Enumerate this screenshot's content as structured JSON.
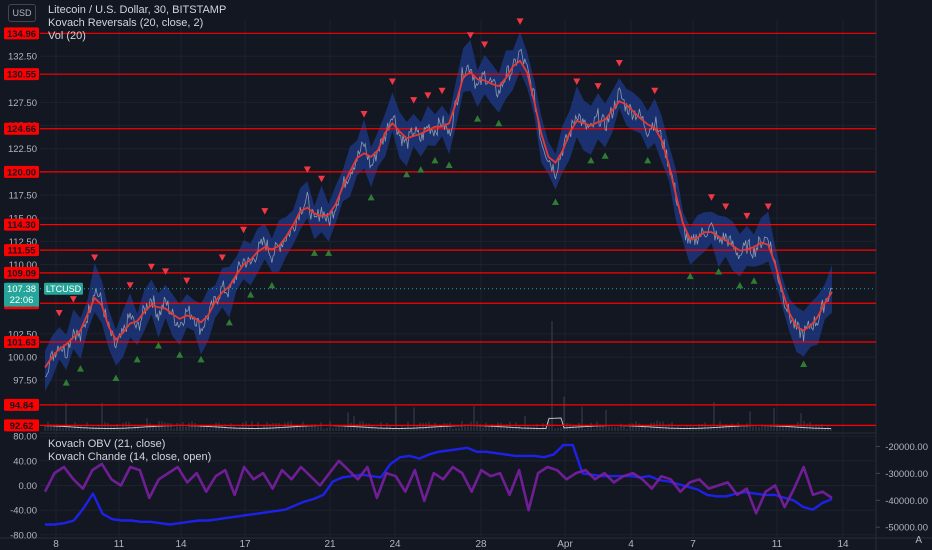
{
  "header": {
    "currency": "USD",
    "title": "Litecoin / U.S. Dollar, 30, BITSTAMP",
    "indicator_1": "Kovach Reversals (20, close, 2)",
    "indicator_2": "Vol (20)",
    "lower_indicator_1": "Kovach OBV (21, close)",
    "lower_indicator_2": "Kovach Chande (14, close, open)",
    "auto_label": "A"
  },
  "colors": {
    "background": "#131722",
    "grid": "#1e222d",
    "level_line": "#ff0000",
    "level_tag": "#ff0000",
    "price_tag": "#26a69a",
    "band": "#1e3a8a",
    "price": "#9aa5b1",
    "ma": "#e53935",
    "arrow_up": "#2e7d32",
    "arrow_down": "#f23645",
    "obv": "#1e22e8",
    "chande": "#7b1fa2",
    "volume": "#5d606b",
    "volume_ma": "#e0e0e0"
  },
  "chart_data": [
    {
      "type": "line",
      "name": "price-panel",
      "y_ticks": [
        "132.50",
        "127.50",
        "125.00",
        "122.50",
        "117.50",
        "115.00",
        "112.50",
        "110.00",
        "102.50",
        "100.00",
        "97.50"
      ],
      "y_tick_values": [
        132.5,
        127.5,
        125.0,
        122.5,
        117.5,
        115.0,
        112.5,
        110.0,
        102.5,
        100.0,
        97.5
      ],
      "ylim": [
        91.8,
        136.4
      ],
      "x_ticks": [
        "8",
        "11",
        "14",
        "17",
        "21",
        "24",
        "28",
        "Apr",
        "4",
        "7",
        "11",
        "14"
      ],
      "levels": [
        "134.96",
        "130.55",
        "124.66",
        "120.00",
        "114.30",
        "111.55",
        "109.09",
        "105.81",
        "101.63",
        "94.84",
        "92.62"
      ],
      "level_values": [
        134.96,
        130.55,
        124.66,
        120.0,
        114.3,
        111.55,
        109.09,
        105.81,
        101.63,
        94.84,
        92.62
      ],
      "current_price": {
        "symbol": "LTCUSD",
        "value": "107.38",
        "countdown": "22:06",
        "numeric": 107.38
      },
      "series": [
        {
          "values": [
            98.5,
            100.0,
            101.5,
            100.5,
            103.0,
            102.0,
            104.5,
            107.5,
            106.0,
            103.0,
            101.0,
            102.5,
            104.5,
            103.0,
            105.0,
            106.5,
            104.5,
            106.0,
            104.5,
            103.5,
            105.0,
            104.5,
            103.0,
            104.5,
            106.0,
            107.5,
            107.0,
            109.0,
            110.5,
            110.0,
            111.5,
            112.5,
            111.0,
            112.0,
            113.0,
            114.0,
            116.0,
            117.0,
            114.5,
            116.0,
            114.5,
            116.5,
            118.5,
            120.0,
            121.5,
            123.0,
            120.5,
            122.5,
            124.0,
            126.5,
            124.0,
            123.0,
            124.5,
            123.5,
            125.0,
            124.5,
            125.5,
            124.0,
            127.5,
            131.0,
            131.5,
            129.0,
            130.5,
            129.5,
            128.5,
            130.5,
            131.0,
            133.0,
            131.0,
            128.0,
            123.5,
            121.5,
            120.0,
            122.5,
            124.0,
            126.5,
            125.0,
            124.5,
            126.0,
            125.0,
            126.5,
            128.5,
            127.0,
            126.5,
            126.0,
            124.5,
            125.5,
            123.5,
            121.0,
            117.5,
            114.0,
            112.0,
            113.0,
            113.5,
            114.0,
            112.5,
            113.0,
            112.0,
            111.0,
            112.0,
            111.5,
            112.5,
            113.0,
            110.0,
            107.0,
            104.5,
            103.0,
            102.5,
            103.5,
            104.0,
            106.0,
            107.38
          ]
        }
      ]
    },
    {
      "type": "line",
      "name": "oscillator-panel",
      "left_ticks": [
        "80.00",
        "40.00",
        "0.00",
        "-40.00",
        "-80.00"
      ],
      "left_tick_values": [
        80,
        40,
        0,
        -40,
        -80
      ],
      "left_ylim": [
        -85,
        85
      ],
      "right_ticks": [
        "-20000.00",
        "-30000.00",
        "-40000.00",
        "-50000.00"
      ],
      "right_tick_values": [
        -20000,
        -30000,
        -40000,
        -50000
      ],
      "right_ylim": [
        -54000,
        -15000
      ],
      "series": [
        {
          "axis": "right",
          "values": [
            -49000,
            -49000,
            -48500,
            -47500,
            -43000,
            -37500,
            -45000,
            -47000,
            -47500,
            -47500,
            -48000,
            -48000,
            -48500,
            -49000,
            -48500,
            -48000,
            -47500,
            -47500,
            -47000,
            -46500,
            -46000,
            -45500,
            -45000,
            -44500,
            -44000,
            -43500,
            -42000,
            -40500,
            -39500,
            -38000,
            -33000,
            -31500,
            -31000,
            -30500,
            -31000,
            -31500,
            -26500,
            -24000,
            -23500,
            -24500,
            -23000,
            -22000,
            -21500,
            -21000,
            -20500,
            -22000,
            -22000,
            -22500,
            -23000,
            -23500,
            -23500,
            -23500,
            -24000,
            -23000,
            -19500,
            -19500,
            -30000,
            -30500,
            -31000,
            -31000,
            -31000,
            -31000,
            -31500,
            -31000,
            -32500,
            -33000,
            -34000,
            -35000,
            -36000,
            -38000,
            -38500,
            -38500,
            -37500,
            -37000,
            -37500,
            -38000,
            -38000,
            -39000,
            -40000,
            -42500,
            -43500,
            -41000,
            -39500
          ]
        },
        {
          "axis": "left",
          "values": [
            -10,
            20,
            30,
            10,
            -5,
            25,
            35,
            10,
            0,
            30,
            25,
            -20,
            10,
            20,
            30,
            5,
            20,
            -10,
            15,
            25,
            -15,
            30,
            10,
            20,
            -5,
            25,
            10,
            30,
            15,
            0,
            20,
            40,
            25,
            10,
            30,
            -20,
            20,
            15,
            -10,
            25,
            -25,
            20,
            10,
            30,
            20,
            -10,
            25,
            15,
            20,
            -15,
            25,
            -40,
            20,
            30,
            25,
            10,
            20,
            25,
            10,
            20,
            5,
            15,
            20,
            10,
            -5,
            15,
            10,
            -10,
            5,
            10,
            -5,
            0,
            5,
            -15,
            -5,
            -45,
            -10,
            0,
            -35,
            -5,
            30,
            -15,
            -10,
            -20
          ]
        }
      ]
    }
  ]
}
